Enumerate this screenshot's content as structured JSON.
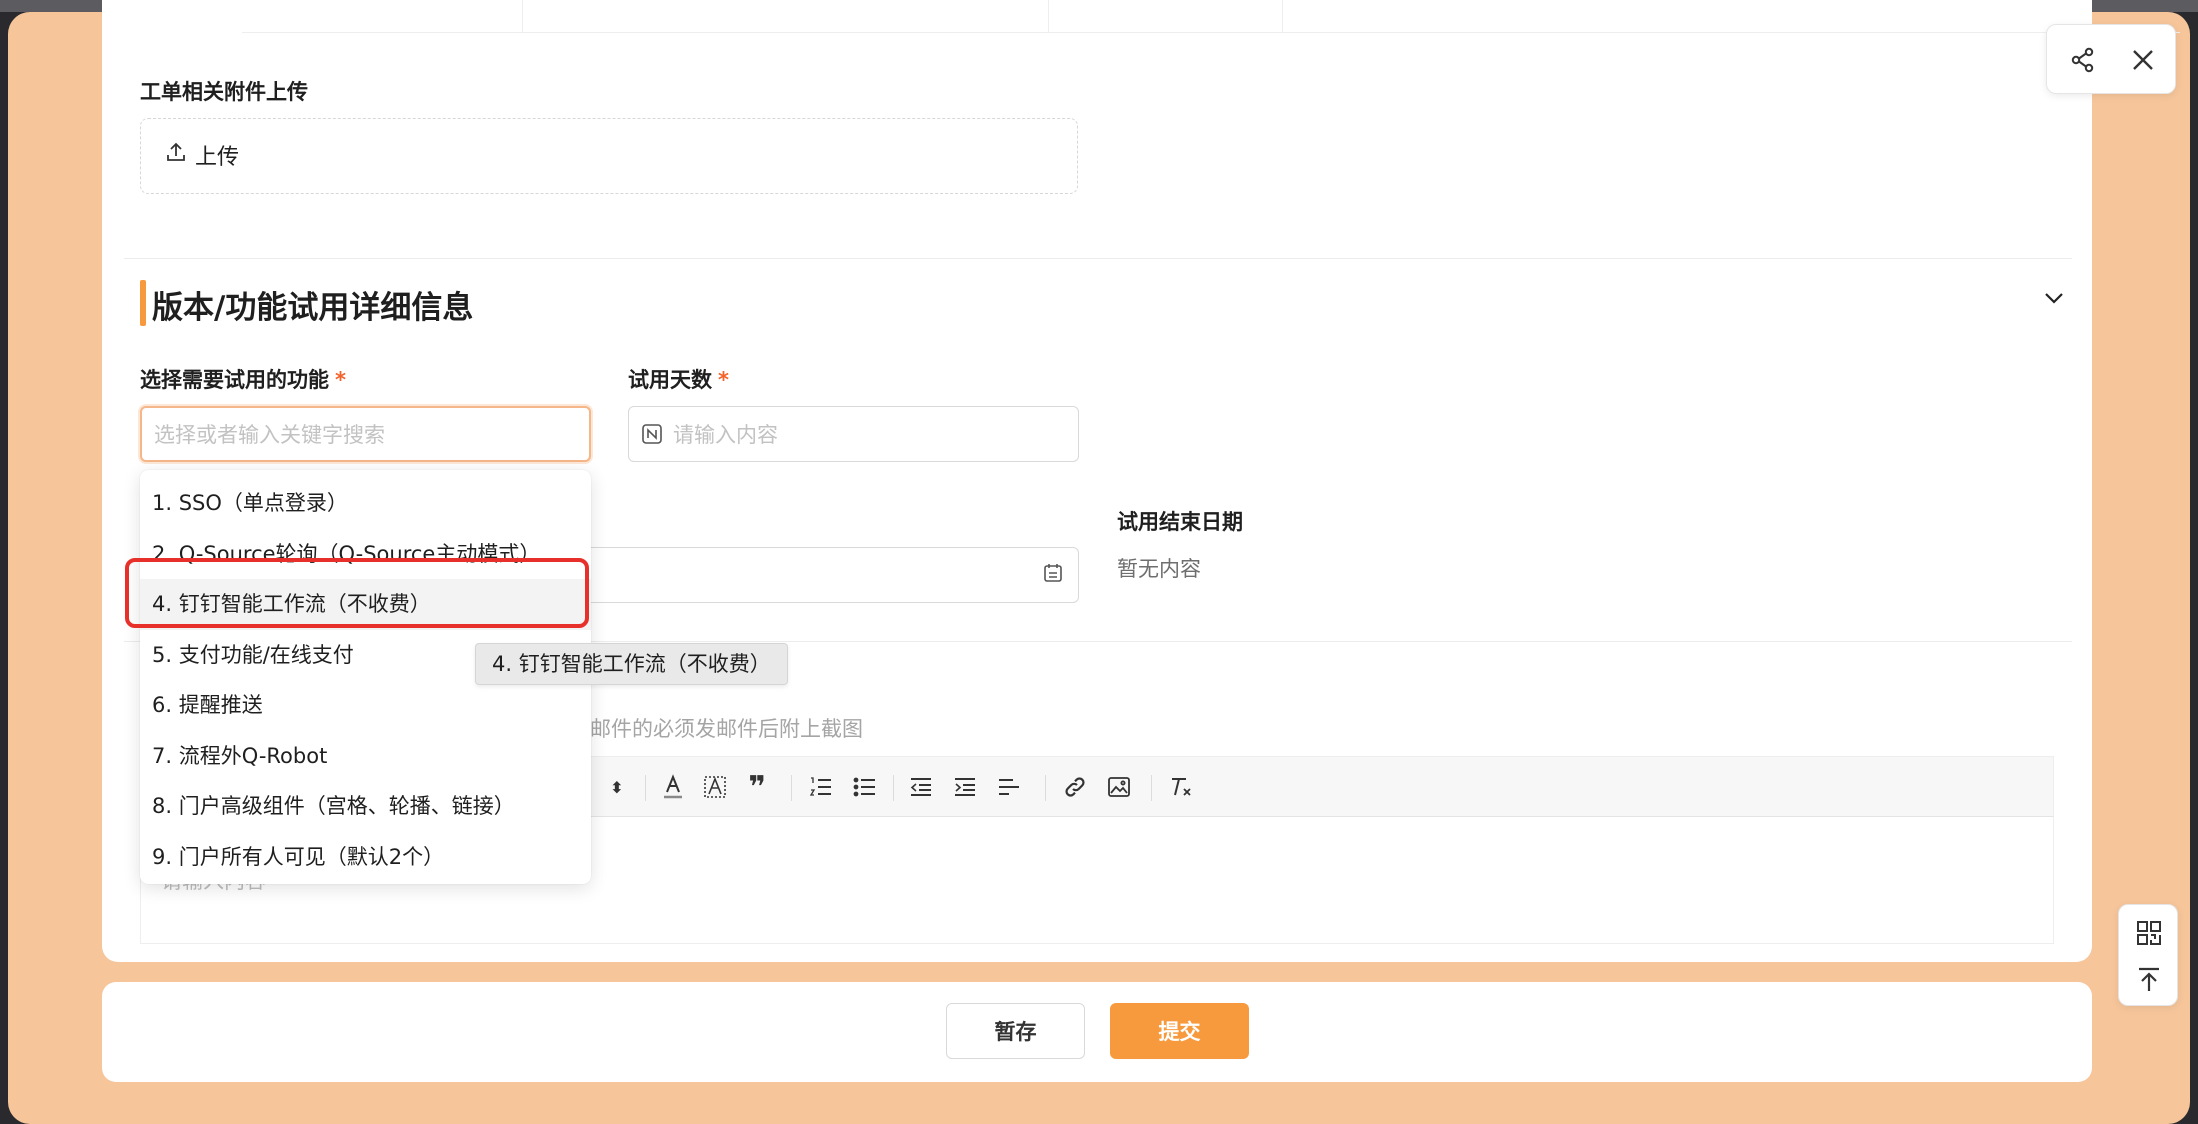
{
  "attachments": {
    "label": "工单相关附件上传",
    "upload_label": "上传"
  },
  "section": {
    "title": "版本/功能试用详细信息"
  },
  "features_field": {
    "label": "选择需要试用的功能",
    "required_mark": "*",
    "placeholder": "选择或者输入关键字搜索"
  },
  "trial_days_field": {
    "label": "试用天数",
    "required_mark": "*",
    "placeholder": "请输入内容"
  },
  "trial_end_date": {
    "label": "试用结束日期",
    "value": "暂无内容"
  },
  "editor": {
    "hint_partial": "邮件的必须发邮件后附上截图",
    "placeholder_partial": "请输入内容"
  },
  "dropdown": {
    "options": [
      "1. SSO（单点登录）",
      "2. Q-Source轮询（Q-Source主动模式）",
      "4. 钉钉智能工作流（不收费）",
      "5. 支付功能/在线支付",
      "6. 提醒推送",
      "7. 流程外Q-Robot",
      "8. 门户高级组件（宫格、轮播、链接）",
      "9. 门户所有人可见（默认2个）"
    ],
    "hovered_index": 2,
    "tooltip": "4. 钉钉智能工作流（不收费）"
  },
  "footer": {
    "save_label": "暂存",
    "submit_label": "提交"
  },
  "colors": {
    "accent": "#f79a3e",
    "highlight": "#e8302a",
    "backdrop": "#f6c59a"
  },
  "icons": {
    "upload": "upload-icon",
    "share": "share-icon",
    "close": "close-icon",
    "collapse": "chevron-down-icon",
    "number": "number-input-icon",
    "calendar": "calendar-icon",
    "qrcode": "qrcode-icon",
    "back_to_top": "back-to-top-icon"
  }
}
